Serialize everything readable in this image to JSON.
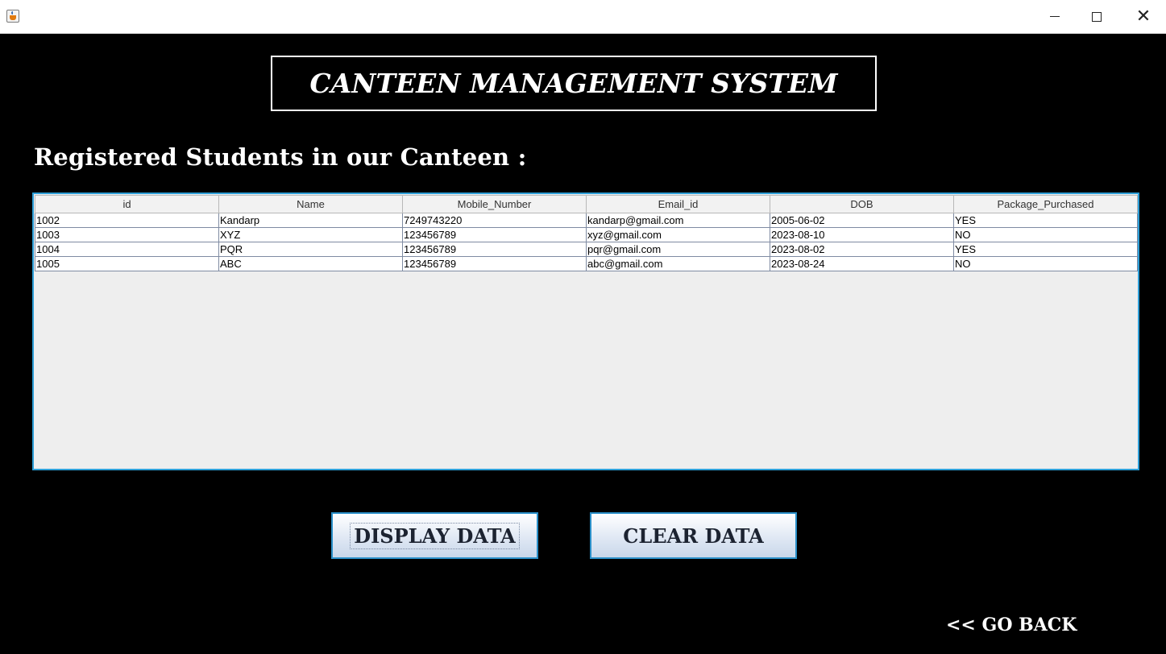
{
  "window": {
    "icon": "java-cup-icon",
    "controls": {
      "minimize": "minimize-icon",
      "maximize": "maximize-icon",
      "close": "✕"
    }
  },
  "header": {
    "title": "CANTEEN MANAGEMENT SYSTEM"
  },
  "section": {
    "heading": "Registered Students in our Canteen :"
  },
  "table": {
    "columns": [
      "id",
      "Name",
      "Mobile_Number",
      "Email_id",
      "DOB",
      "Package_Purchased"
    ],
    "rows": [
      [
        "1002",
        "Kandarp",
        "7249743220",
        "kandarp@gmail.com",
        "2005-06-02",
        "YES"
      ],
      [
        "1003",
        "XYZ",
        "123456789",
        "xyz@gmail.com",
        "2023-08-10",
        "NO"
      ],
      [
        "1004",
        "PQR",
        "123456789",
        "pqr@gmail.com",
        "2023-08-02",
        "YES"
      ],
      [
        "1005",
        "ABC",
        "123456789",
        "abc@gmail.com",
        "2023-08-24",
        "NO"
      ]
    ]
  },
  "buttons": {
    "display": "DISPLAY DATA",
    "clear": "CLEAR DATA"
  },
  "nav": {
    "go_back": "<< GO BACK"
  },
  "colors": {
    "background": "#000000",
    "accent_border": "#2e9fd8",
    "button_border": "#2a8fc8"
  }
}
